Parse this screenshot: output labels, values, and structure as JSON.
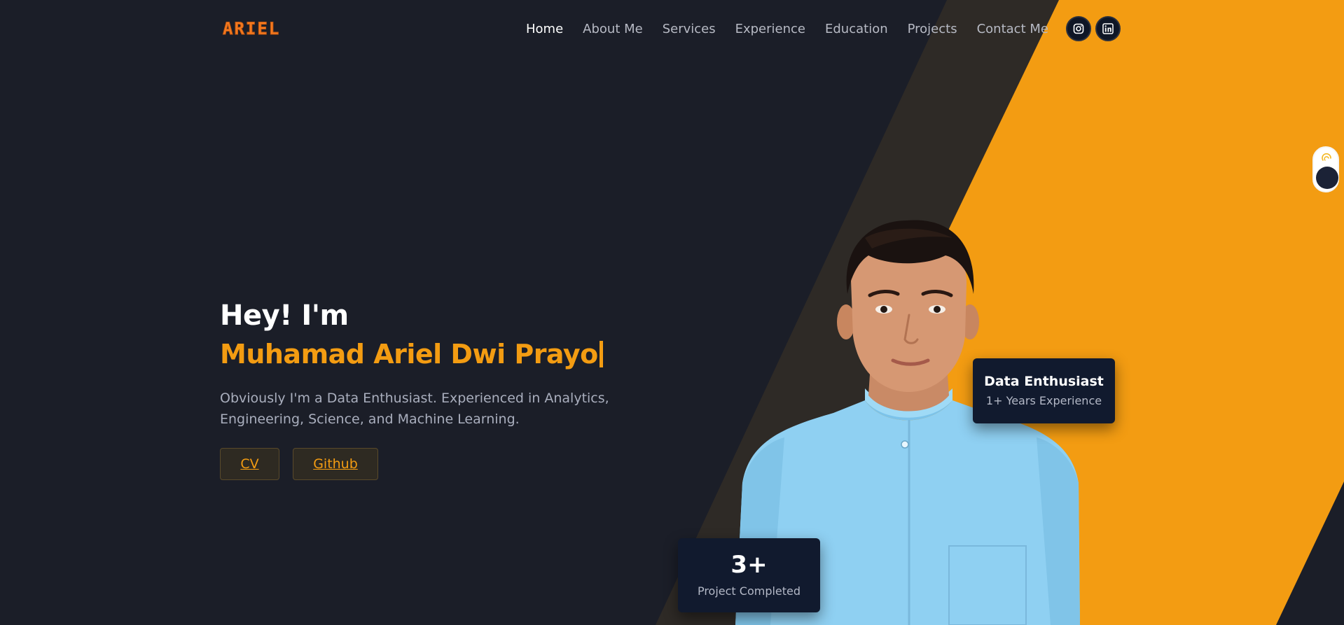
{
  "header": {
    "logo": "ARIEL",
    "nav": [
      {
        "label": "Home",
        "active": true
      },
      {
        "label": "About Me",
        "active": false
      },
      {
        "label": "Services",
        "active": false
      },
      {
        "label": "Experience",
        "active": false
      },
      {
        "label": "Education",
        "active": false
      },
      {
        "label": "Projects",
        "active": false
      },
      {
        "label": "Contact Me",
        "active": false
      }
    ],
    "social": [
      {
        "icon": "instagram-icon"
      },
      {
        "icon": "linkedin-icon"
      }
    ]
  },
  "hero": {
    "greeting": "Hey! I'm",
    "name": "Muhamad Ariel Dwi Prayo",
    "description": "Obviously I'm a Data Enthusiast. Experienced in Analytics, Engineering, Science, and Machine Learning.",
    "buttons": {
      "cv": "CV",
      "github": "Github"
    }
  },
  "cards": {
    "experience": {
      "title": "Data Enthusiast",
      "subtitle": "1+ Years Experience"
    },
    "projects": {
      "title": "3+",
      "subtitle": "Project Completed"
    }
  },
  "theme_toggle": {
    "icon": "sun-icon",
    "state": "dark"
  },
  "colors": {
    "background": "#1b1e28",
    "accent": "#f39c12",
    "logo": "#f47a20",
    "card": "#111a2e",
    "stripe": "#2e2a26"
  }
}
